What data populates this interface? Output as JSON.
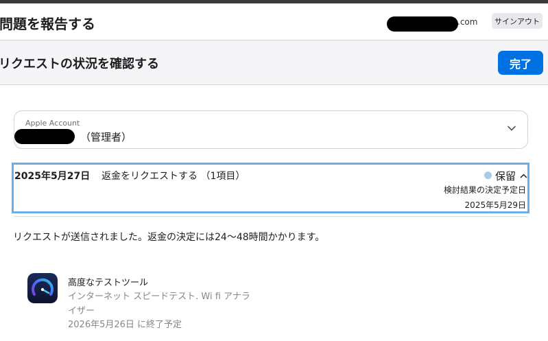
{
  "header": {
    "title": "問題を報告する",
    "account_domain": ".com",
    "signout_label": "サインアウト"
  },
  "subheader": {
    "title": "リクエストの状況を確認する",
    "done_label": "完了"
  },
  "account_select": {
    "label": "Apple Account",
    "role": "（管理者）"
  },
  "request": {
    "date": "2025年5月27日",
    "description": "返金をリクエストする （1項目）",
    "status": "保留",
    "decision_label": "検討結果の決定予定日",
    "decision_date": "2025年5月29日"
  },
  "message": "リクエストが送信されました。返金の決定には24〜48時間かかります。",
  "item": {
    "title": "高度なテストツール",
    "subtitle_line1": "インターネット スピードテスト. Wi ﬁ アナラ",
    "subtitle_line2": "イザー",
    "expiry": "2026年5月26日 に終了予定"
  },
  "colors": {
    "accent": "#0071e3",
    "card_border": "#6aaee8",
    "status_dot": "#a9cbe8"
  },
  "icons": {
    "dropdown": "chevron-down-icon",
    "collapse": "chevron-up-icon",
    "app": "speedometer-app-icon"
  }
}
